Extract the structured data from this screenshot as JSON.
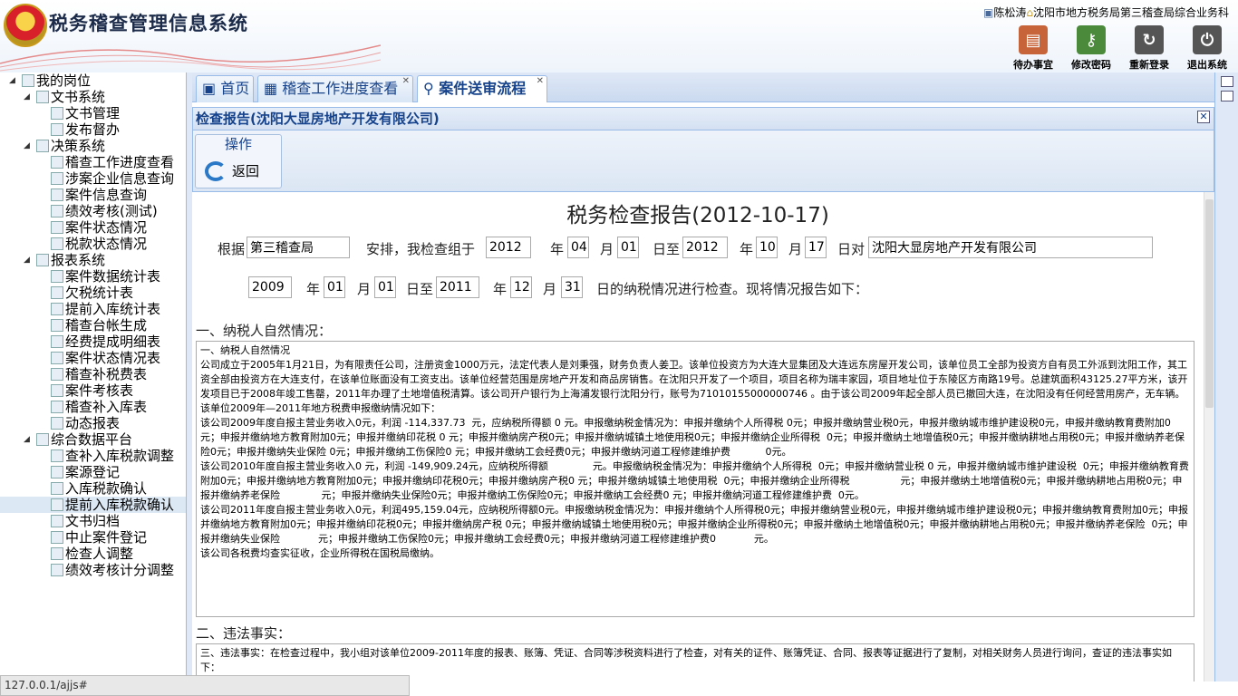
{
  "app": {
    "title": "税务稽查管理信息系统",
    "user_name": "陈松涛",
    "user_org": "沈阳市地方税务局第三稽查局综合业务科"
  },
  "top_buttons": [
    {
      "label": "待办事宜",
      "icon": "clipboard-icon",
      "color": "#c8643a"
    },
    {
      "label": "修改密码",
      "icon": "key-icon",
      "color": "#4a8a3a"
    },
    {
      "label": "重新登录",
      "icon": "relogin-icon",
      "color": "#555555"
    },
    {
      "label": "退出系统",
      "icon": "power-icon",
      "color": "#555555"
    }
  ],
  "sidebar": {
    "root": "我的岗位",
    "groups": [
      {
        "label": "文书系统",
        "items": [
          "文书管理",
          "发布督办"
        ]
      },
      {
        "label": "决策系统",
        "items": [
          "稽查工作进度查看",
          "涉案企业信息查询",
          "案件信息查询",
          "绩效考核(测试)",
          "案件状态情况",
          "税款状态情况"
        ]
      },
      {
        "label": "报表系统",
        "items": [
          "案件数据统计表",
          "欠税统计表",
          "提前入库统计表",
          "稽查台帐生成",
          "经费提成明细表",
          "案件状态情况表",
          "稽查补税费表",
          "案件考核表",
          "稽查补入库表",
          "动态报表"
        ]
      },
      {
        "label": "综合数据平台",
        "items": [
          "查补入库税款调整",
          "案源登记",
          "入库税款确认",
          "提前入库税款确认",
          "文书归档",
          "中止案件登记",
          "检查人调整",
          "绩效考核计分调整"
        ]
      }
    ],
    "selected": "提前入库税款确认"
  },
  "tabs": [
    {
      "label": "首页"
    },
    {
      "label": "稽查工作进度查看"
    },
    {
      "label": "案件送审流程"
    }
  ],
  "panel": {
    "title": "检查报告(沈阳大显房地产开发有限公司)",
    "toolbar_group": "操作",
    "back_label": "返回"
  },
  "report": {
    "title": "税务检查报告(2012-10-17)",
    "line1": {
      "p1": "根据",
      "bureau": "第三稽查局",
      "p2": "安排，我检查组于",
      "y1": "2012",
      "t_year": "年",
      "m1": "04",
      "t_month": "月",
      "d1": "01",
      "t_dayto": "日至",
      "y2": "2012",
      "m2": "10",
      "d2": "17",
      "t_dayon": "日对",
      "company": "沈阳大显房地产开发有限公司"
    },
    "line2": {
      "y3": "2009",
      "m3": "01",
      "d3": "01",
      "y4": "2011",
      "m4": "12",
      "d4": "31",
      "tail": "日的纳税情况进行检查。现将情况报告如下："
    },
    "section1_title": "一、纳税人自然情况：",
    "section1_text": "一、纳税人自然情况\n公司成立于2005年1月21日，为有限责任公司，注册资金1000万元，法定代表人是刘秉强，财务负责人姜卫。该单位投资方为大连大显集团及大连远东房屋开发公司，该单位员工全部为投资方自有员工外派到沈阳工作，其工资全部由投资方在大连支付，在该单位账面没有工资支出。该单位经营范围是房地产开发和商品房销售。在沈阳只开发了一个项目，项目名称为瑞丰家园，项目地址位于东陵区方南路19号。总建筑面积43125.27平方米，该开发项目已于2008年竣工售罄，2011年办理了土地增值税清算。该公司开户银行为上海浦发银行沈阳分行，账号为71010155000000746 。由于该公司2009年起全部人员已撤回大连，在沈阳没有任何经营用房产，无车辆。\n该单位2009年—2011年地方税费申报缴纳情况如下：\n该公司2009年度自报主营业务收入0元，利润 -114,337.73  元，应纳税所得额 0 元。申报缴纳税金情况为：申报并缴纳个人所得税 0元；申报并缴纳营业税0元，申报并缴纳城市维护建设税0元，申报并缴纳教育费附加0元；申报并缴纳地方教育附加0元；申报并缴纳印花税 0 元；申报并缴纳房产税0元；申报并缴纳城镇土地使用税0元；申报并缴纳企业所得税  0元；申报并缴纳土地增值税0元；申报并缴纳耕地占用税0元；申报并缴纳养老保险0元；申报并缴纳失业保险 0元；申报并缴纳工伤保险0 元；申报并缴纳工会经费0元；申报并缴纳河道工程修建维护费           0元。\n该公司2010年度自报主营业务收入0 元，利润 -149,909.24元，应纳税所得额              元。申报缴纳税金情况为：申报并缴纳个人所得税  0元；申报并缴纳营业税 0 元，申报并缴纳城市维护建设税  0元；申报并缴纳教育费附加0元；申报并缴纳地方教育附加0元；申报并缴纳印花税0元；申报并缴纳房产税0 元；申报并缴纳城镇土地使用税  0元；申报并缴纳企业所得税                元；申报并缴纳土地增值税0元；申报并缴纳耕地占用税0元；申报并缴纳养老保险             元；申报并缴纳失业保险0元；申报并缴纳工伤保险0元；申报并缴纳工会经费0 元；申报并缴纳河道工程修建维护费  0元。\n该公司2011年度自报主营业务收入0元，利润495,159.04元，应纳税所得额0元。申报缴纳税金情况为：申报并缴纳个人所得税0元；申报并缴纳营业税0元，申报并缴纳城市维护建设税0元；申报并缴纳教育费附加0元；申报并缴纳地方教育附加0元；申报并缴纳印花税0元；申报并缴纳房产税 0元；申报并缴纳城镇土地使用税0元；申报并缴纳企业所得税0元；申报并缴纳土地增值税0元；申报并缴纳耕地占用税0元；申报并缴纳养老保险  0元；申报并缴纳失业保险            元；申报并缴纳工伤保险0元；申报并缴纳工会经费0元；申报并缴纳河道工程修建维护费0            元。\n该公司各税费均查实征收，企业所得税在国税局缴纳。",
    "section2_title": "二、违法事实：",
    "section2_text": "三、违法事实：在检查过程中，我小组对该单位2009-2011年度的报表、账簿、凭证、合同等涉税资料进行了检查，对有关的证件、账簿凭证、合同、报表等证据进行了复制，对相关财务人员进行询问，查证的违法事实如下："
  },
  "status_bar": "127.0.0.1/ajjs#"
}
